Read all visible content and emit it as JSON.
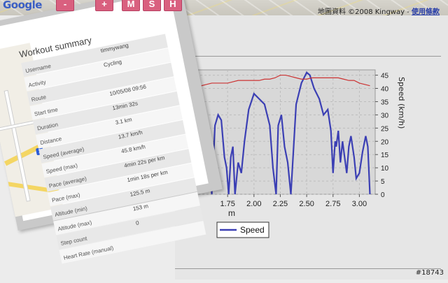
{
  "map": {
    "logo": "Google",
    "controls": [
      "-",
      "+",
      "M",
      "S",
      "H"
    ],
    "attribution": "地圖資料 ©2008 Kingway -",
    "terms_link": "使用條款"
  },
  "summary": {
    "title": "Workout summary",
    "rows": [
      {
        "label": "Username",
        "value": "timmywang"
      },
      {
        "label": "Activity",
        "value": "Cycling"
      },
      {
        "label": "Route",
        "value": ""
      },
      {
        "label": "Start time",
        "value": "10/05/08 09:56"
      },
      {
        "label": "Duration",
        "value": "13min 32s"
      },
      {
        "label": "Distance",
        "value": "3.1 km"
      },
      {
        "label": "Speed (average)",
        "value": "13.7 km/h"
      },
      {
        "label": "Speed (max)",
        "value": "45.8 km/h"
      },
      {
        "label": "Pace (average)",
        "value": "4min 22s per km"
      },
      {
        "label": "Pace (max)",
        "value": "1min 18s per km"
      },
      {
        "label": "Altitude (min)",
        "value": "125.5 m"
      },
      {
        "label": "Altitude (max)",
        "value": "153 m"
      },
      {
        "label": "Step count",
        "value": "0"
      },
      {
        "label": "Heart Rate (manual)",
        "value": ""
      }
    ]
  },
  "chart_data": {
    "type": "line",
    "xlabel_visible": "m",
    "x_ticks": [
      "1.75",
      "2.00",
      "2.25",
      "2.50",
      "2.75",
      "3.00"
    ],
    "y_right_ticks": [
      "0",
      "5",
      "10",
      "15",
      "20",
      "25",
      "30",
      "35",
      "40",
      "45"
    ],
    "y_right_label": "Speed (km/h)",
    "ylim": [
      0,
      47
    ],
    "xlim": [
      1.45,
      3.15
    ],
    "series": [
      {
        "name": "Speed",
        "color": "#3b3fb4",
        "x": [
          1.45,
          1.5,
          1.52,
          1.55,
          1.58,
          1.6,
          1.63,
          1.66,
          1.69,
          1.72,
          1.74,
          1.76,
          1.78,
          1.8,
          1.82,
          1.85,
          1.88,
          1.91,
          1.95,
          2.0,
          2.05,
          2.1,
          2.15,
          2.18,
          2.21,
          2.23,
          2.26,
          2.29,
          2.32,
          2.35,
          2.4,
          2.45,
          2.5,
          2.53,
          2.57,
          2.62,
          2.66,
          2.7,
          2.73,
          2.75,
          2.77,
          2.78,
          2.8,
          2.82,
          2.84,
          2.86,
          2.88,
          2.9,
          2.92,
          2.95,
          2.97,
          3.0,
          3.03,
          3.06,
          3.08,
          3.1
        ],
        "values": [
          10,
          12,
          16,
          18,
          10,
          0,
          26,
          30,
          28,
          14,
          10,
          0,
          14,
          18,
          0,
          12,
          8,
          20,
          32,
          38,
          36,
          34,
          26,
          10,
          0,
          26,
          30,
          18,
          12,
          0,
          34,
          42,
          46,
          45,
          40,
          36,
          30,
          32,
          24,
          8,
          20,
          18,
          24,
          12,
          20,
          14,
          8,
          18,
          22,
          14,
          6,
          8,
          16,
          22,
          18,
          0
        ]
      },
      {
        "name": "",
        "color": "#cc3333",
        "x": [
          1.45,
          1.5,
          1.55,
          1.6,
          1.65,
          1.7,
          1.75,
          1.8,
          1.85,
          1.9,
          1.95,
          2.0,
          2.05,
          2.1,
          2.15,
          2.2,
          2.25,
          2.3,
          2.35,
          2.4,
          2.45,
          2.5,
          2.55,
          2.6,
          2.65,
          2.7,
          2.75,
          2.8,
          2.85,
          2.9,
          2.95,
          3.0,
          3.05,
          3.1
        ],
        "values": [
          41,
          41,
          41.5,
          42,
          42,
          42,
          42,
          42.5,
          43,
          43,
          43,
          43,
          43,
          43.5,
          43.5,
          44,
          45,
          45,
          44.5,
          44,
          43.5,
          43.5,
          44,
          44,
          44,
          44,
          44,
          44,
          43.5,
          43,
          43,
          42,
          41.5,
          41
        ]
      }
    ],
    "legend": "Speed"
  },
  "watermark": "#18743"
}
